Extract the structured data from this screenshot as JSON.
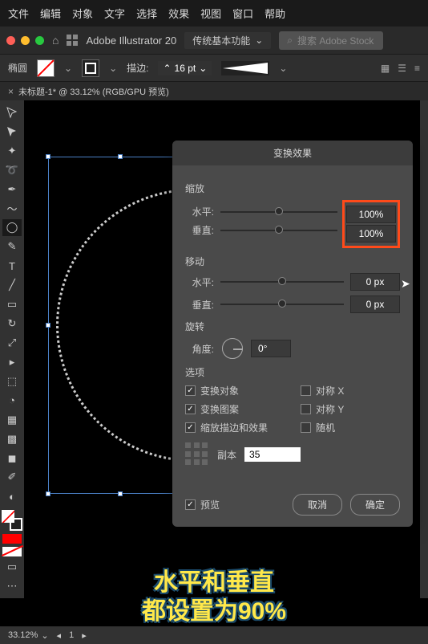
{
  "menu": {
    "file": "文件",
    "edit": "编辑",
    "object": "对象",
    "type": "文字",
    "select": "选择",
    "effect": "效果",
    "view": "视图",
    "window": "窗口",
    "help": "帮助"
  },
  "header": {
    "app_name": "Adobe Illustrator 20",
    "workspace": "传统基本功能",
    "search_placeholder": "搜索 Adobe Stock"
  },
  "propbar": {
    "tool_name": "椭圆",
    "stroke_label": "描边:",
    "stroke_size": "16 pt"
  },
  "tab": {
    "name": "未标题-1* @ 33.12% (RGB/GPU 预览)"
  },
  "dialog": {
    "title": "变换效果",
    "scale": {
      "label": "缩放",
      "horizontal_label": "水平:",
      "vertical_label": "垂直:",
      "horizontal_value": "100%",
      "vertical_value": "100%"
    },
    "move": {
      "label": "移动",
      "horizontal_label": "水平:",
      "vertical_label": "垂直:",
      "horizontal_value": "0 px",
      "vertical_value": "0 px"
    },
    "rotate": {
      "label": "旋转",
      "angle_label": "角度:",
      "angle_value": "0°"
    },
    "options": {
      "label": "选项",
      "transform_objects": "变换对象",
      "transform_patterns": "变换图案",
      "scale_strokes": "缩放描边和效果",
      "reflect_x": "对称 X",
      "reflect_y": "对称 Y",
      "random": "随机"
    },
    "copies": {
      "label": "副本",
      "value": "35"
    },
    "preview": "预览",
    "cancel": "取消",
    "ok": "确定"
  },
  "status": {
    "zoom": "33.12%",
    "page": "1"
  },
  "caption": {
    "line1": "水平和垂直",
    "line2": "都设置为90%"
  }
}
